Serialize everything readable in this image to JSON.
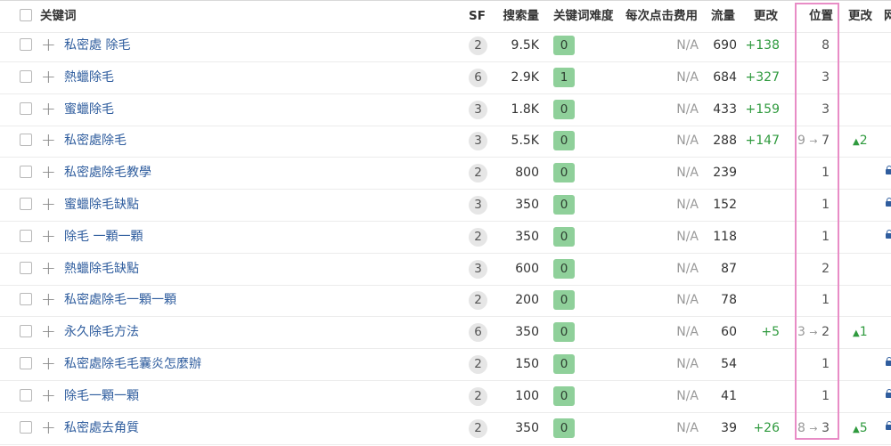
{
  "headers": {
    "keyword": "关键词",
    "sf": "SF",
    "volume": "搜索量",
    "kd": "关键词难度",
    "cpc": "每次点击费用",
    "traffic": "流量",
    "change": "更改",
    "position": "位置",
    "position_change": "更改",
    "extra": "网"
  },
  "rows": [
    {
      "keyword": "私密處 除毛",
      "sf": "2",
      "volume": "9.5K",
      "kd": "0",
      "cpc": "N/A",
      "traffic": "690",
      "change": "+138",
      "pos_old": "",
      "pos_arrow": "",
      "position": "8",
      "pos_change": "",
      "pos_tri": "",
      "lock": false
    },
    {
      "keyword": "熱蠟除毛",
      "sf": "6",
      "volume": "2.9K",
      "kd": "1",
      "cpc": "N/A",
      "traffic": "684",
      "change": "+327",
      "pos_old": "",
      "pos_arrow": "",
      "position": "3",
      "pos_change": "",
      "pos_tri": "",
      "lock": false
    },
    {
      "keyword": "蜜蠟除毛",
      "sf": "3",
      "volume": "1.8K",
      "kd": "0",
      "cpc": "N/A",
      "traffic": "433",
      "change": "+159",
      "pos_old": "",
      "pos_arrow": "",
      "position": "3",
      "pos_change": "",
      "pos_tri": "",
      "lock": false
    },
    {
      "keyword": "私密處除毛",
      "sf": "3",
      "volume": "5.5K",
      "kd": "0",
      "cpc": "N/A",
      "traffic": "288",
      "change": "+147",
      "pos_old": "9",
      "pos_arrow": "→",
      "position": "7",
      "pos_change": "2",
      "pos_tri": "▲",
      "lock": false
    },
    {
      "keyword": "私密處除毛教學",
      "sf": "2",
      "volume": "800",
      "kd": "0",
      "cpc": "N/A",
      "traffic": "239",
      "change": "",
      "pos_old": "",
      "pos_arrow": "",
      "position": "1",
      "pos_change": "",
      "pos_tri": "",
      "lock": true
    },
    {
      "keyword": "蜜蠟除毛缺點",
      "sf": "3",
      "volume": "350",
      "kd": "0",
      "cpc": "N/A",
      "traffic": "152",
      "change": "",
      "pos_old": "",
      "pos_arrow": "",
      "position": "1",
      "pos_change": "",
      "pos_tri": "",
      "lock": true
    },
    {
      "keyword": "除毛 一顆一顆",
      "sf": "2",
      "volume": "350",
      "kd": "0",
      "cpc": "N/A",
      "traffic": "118",
      "change": "",
      "pos_old": "",
      "pos_arrow": "",
      "position": "1",
      "pos_change": "",
      "pos_tri": "",
      "lock": true
    },
    {
      "keyword": "熱蠟除毛缺點",
      "sf": "3",
      "volume": "600",
      "kd": "0",
      "cpc": "N/A",
      "traffic": "87",
      "change": "",
      "pos_old": "",
      "pos_arrow": "",
      "position": "2",
      "pos_change": "",
      "pos_tri": "",
      "lock": false
    },
    {
      "keyword": "私密處除毛一顆一顆",
      "sf": "2",
      "volume": "200",
      "kd": "0",
      "cpc": "N/A",
      "traffic": "78",
      "change": "",
      "pos_old": "",
      "pos_arrow": "",
      "position": "1",
      "pos_change": "",
      "pos_tri": "",
      "lock": false
    },
    {
      "keyword": "永久除毛方法",
      "sf": "6",
      "volume": "350",
      "kd": "0",
      "cpc": "N/A",
      "traffic": "60",
      "change": "+5",
      "pos_old": "3",
      "pos_arrow": "→",
      "position": "2",
      "pos_change": "1",
      "pos_tri": "▲",
      "lock": false
    },
    {
      "keyword": "私密處除毛毛囊炎怎麼辦",
      "sf": "2",
      "volume": "150",
      "kd": "0",
      "cpc": "N/A",
      "traffic": "54",
      "change": "",
      "pos_old": "",
      "pos_arrow": "",
      "position": "1",
      "pos_change": "",
      "pos_tri": "",
      "lock": true
    },
    {
      "keyword": "除毛一顆一顆",
      "sf": "2",
      "volume": "100",
      "kd": "0",
      "cpc": "N/A",
      "traffic": "41",
      "change": "",
      "pos_old": "",
      "pos_arrow": "",
      "position": "1",
      "pos_change": "",
      "pos_tri": "",
      "lock": true
    },
    {
      "keyword": "私密處去角質",
      "sf": "2",
      "volume": "350",
      "kd": "0",
      "cpc": "N/A",
      "traffic": "39",
      "change": "+26",
      "pos_old": "8",
      "pos_arrow": "→",
      "position": "3",
      "pos_change": "5",
      "pos_tri": "▲",
      "lock": true
    }
  ],
  "colors": {
    "link": "#2f5d9e",
    "kd_badge": "#8fd09a",
    "positive": "#2f9a3e",
    "highlight_border": "#e88cc6"
  }
}
